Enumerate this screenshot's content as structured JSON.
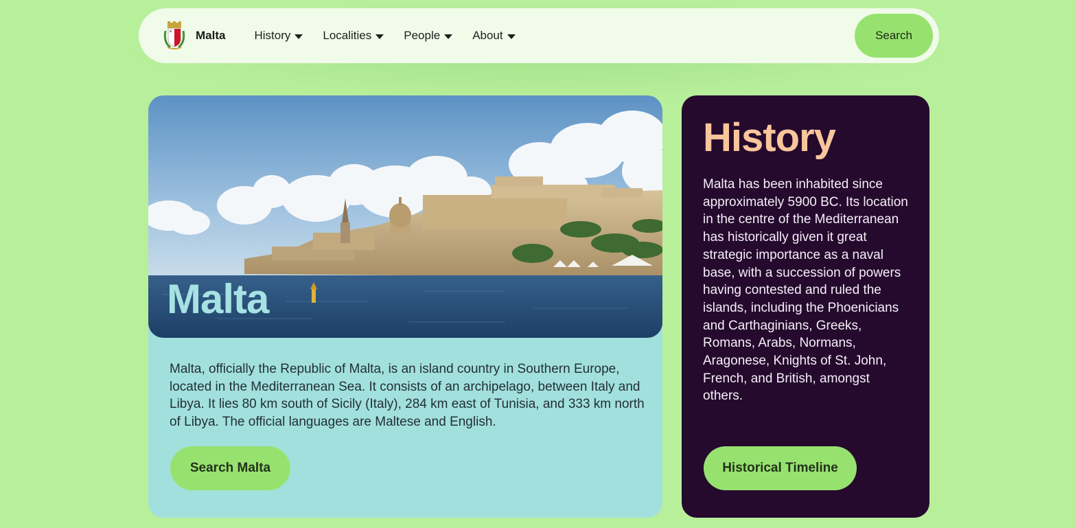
{
  "nav": {
    "brand": "Malta",
    "menu": [
      {
        "label": "History"
      },
      {
        "label": "Localities"
      },
      {
        "label": "People"
      },
      {
        "label": "About"
      }
    ],
    "search_label": "Search"
  },
  "main": {
    "title": "Malta",
    "description": "Malta, officially the Republic of Malta, is an island country in Southern Europe, located in the Mediterranean Sea. It consists of an archipelago, between Italy and Libya. It lies 80 km south of Sicily (Italy), 284 km east of Tunisia, and 333 km north of Libya. The official languages are Maltese and English.",
    "button_label": "Search Malta"
  },
  "history": {
    "title": "History",
    "description": "Malta has been inhabited since approximately 5900 BC. Its location in the centre of the Mediterranean has historically given it great strategic importance as a naval base, with a succession of powers having contested and ruled the islands, including the Phoenicians and Carthaginians, Greeks, Romans, Arabs, Normans, Aragonese, Knights of St. John, French, and British, amongst others.",
    "button_label": "Historical Timeline"
  },
  "colors": {
    "page_background": "#b8ef9b",
    "nav_background": "#f0fbe9",
    "button_green": "#97e26f",
    "main_card": "#a2e0dd",
    "history_card": "#250a2e",
    "history_title": "#f9c59b"
  },
  "icons": {
    "brand": "malta-coat-of-arms-icon",
    "dropdown": "caret-down-icon"
  }
}
